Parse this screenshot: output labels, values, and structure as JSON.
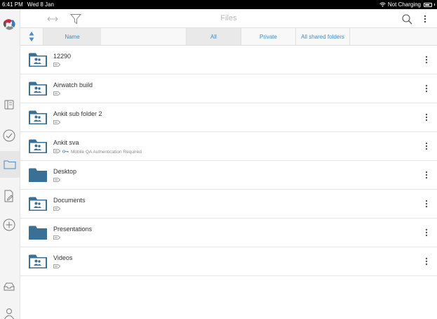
{
  "status_bar": {
    "time": "6:41 PM",
    "date": "Wed 8 Jan",
    "charging": "Not Charging"
  },
  "header": {
    "title": "Files"
  },
  "filter_bar": {
    "tabs": [
      {
        "label": "Name"
      },
      {
        "label": "All"
      },
      {
        "label": "Private"
      },
      {
        "label": "All shared folders"
      }
    ]
  },
  "files": [
    {
      "name": "12290",
      "type": "shared-folder",
      "status": ""
    },
    {
      "name": "Airwatch build",
      "type": "shared-folder",
      "status": ""
    },
    {
      "name": "Ankit sub folder 2",
      "type": "shared-folder",
      "status": ""
    },
    {
      "name": "Ankit sva",
      "type": "shared-folder",
      "status": "Mobile QA Authentication Required"
    },
    {
      "name": "Desktop",
      "type": "folder",
      "status": ""
    },
    {
      "name": "Documents",
      "type": "shared-folder",
      "status": ""
    },
    {
      "name": "Presentations",
      "type": "folder",
      "status": ""
    },
    {
      "name": "Videos",
      "type": "shared-folder",
      "status": ""
    }
  ],
  "colors": {
    "folder": "#3a6f96",
    "accent": "#3c8cc6",
    "brand_red": "#c8283c",
    "brand_blue": "#3a7cb8",
    "brand_grey": "#8a8a8a"
  },
  "icons": {
    "sidebar": [
      "library-icon",
      "checkmark-circle-icon",
      "folder-icon",
      "document-edit-icon",
      "add-circle-icon",
      "inbox-icon",
      "user-icon"
    ],
    "header": [
      "back-forward-arrows-icon",
      "filter-icon",
      "search-icon",
      "more-vertical-icon"
    ]
  }
}
